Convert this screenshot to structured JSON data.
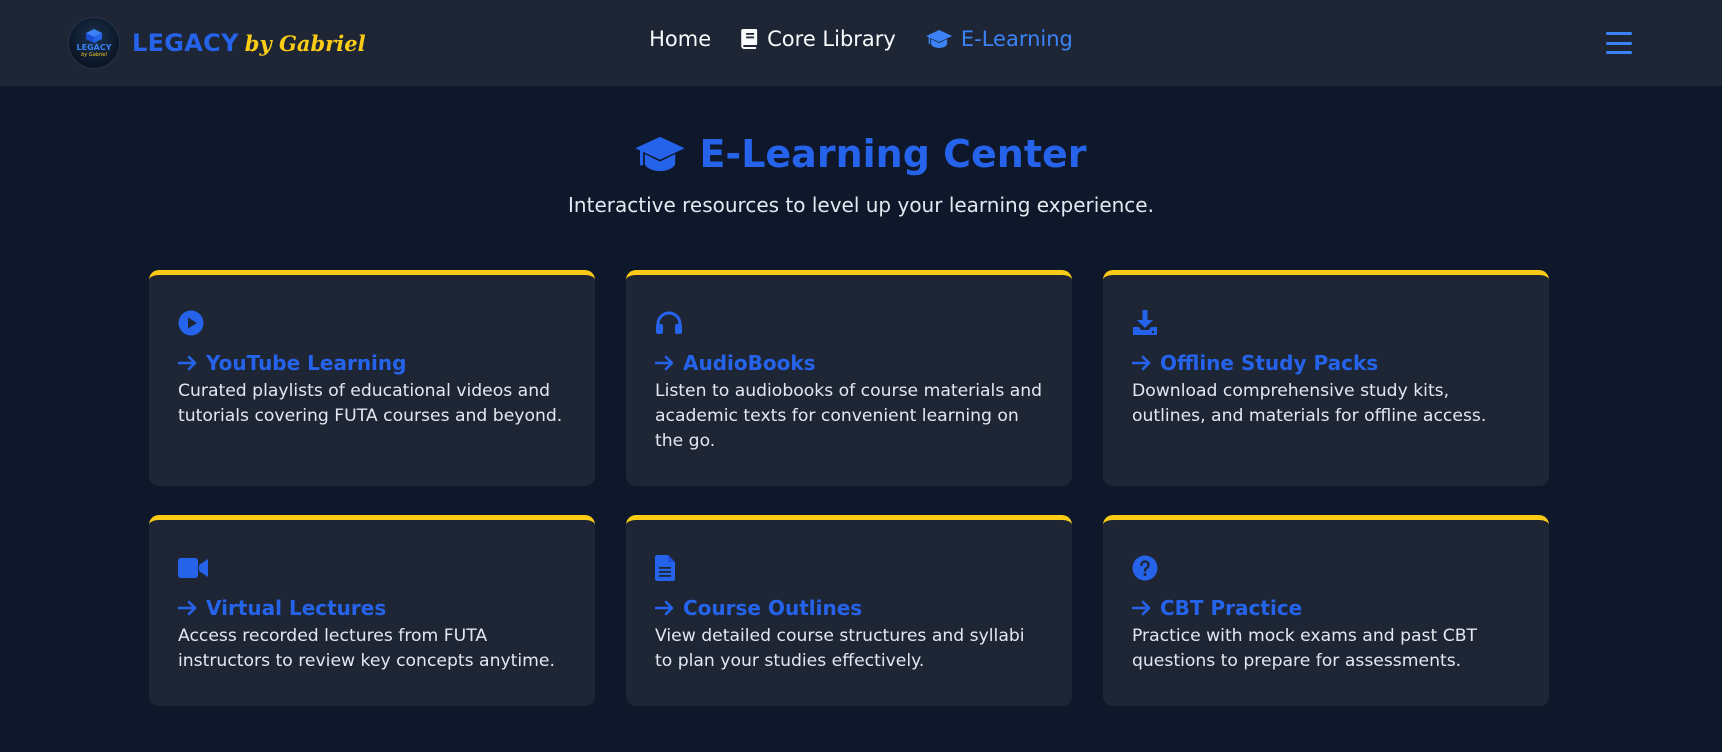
{
  "brand": {
    "name": "LEGACY",
    "by": "by Gabriel",
    "logo_text": "LEGACY",
    "logo_sub": "by Gabriel"
  },
  "nav": [
    {
      "label": "Home",
      "icon": "",
      "active": false
    },
    {
      "label": "Core Library",
      "icon": "book-icon",
      "active": false
    },
    {
      "label": "E-Learning",
      "icon": "graduation-cap-icon",
      "active": true
    }
  ],
  "hero": {
    "title": "E-Learning Center",
    "subtitle": "Interactive resources to level up your learning experience."
  },
  "cards": [
    {
      "icon": "play-circle-icon",
      "title": "YouTube Learning",
      "desc": "Curated playlists of educational videos and tutorials covering FUTA courses and beyond."
    },
    {
      "icon": "headphones-icon",
      "title": "AudioBooks",
      "desc": "Listen to audiobooks of course materials and academic texts for convenient learning on the go."
    },
    {
      "icon": "download-icon",
      "title": "Offline Study Packs",
      "desc": "Download comprehensive study kits, outlines, and materials for offline access."
    },
    {
      "icon": "video-camera-icon",
      "title": "Virtual Lectures",
      "desc": "Access recorded lectures from FUTA instructors to review key concepts anytime."
    },
    {
      "icon": "document-icon",
      "title": "Course Outlines",
      "desc": "View detailed course structures and syllabi to plan your studies effectively."
    },
    {
      "icon": "question-circle-icon",
      "title": "CBT Practice",
      "desc": "Practice with mock exams and past CBT questions to prepare for assessments."
    }
  ],
  "colors": {
    "accent": "#2563eb",
    "highlight": "#facc15",
    "background": "#0f172a",
    "surface": "#1e2636"
  }
}
